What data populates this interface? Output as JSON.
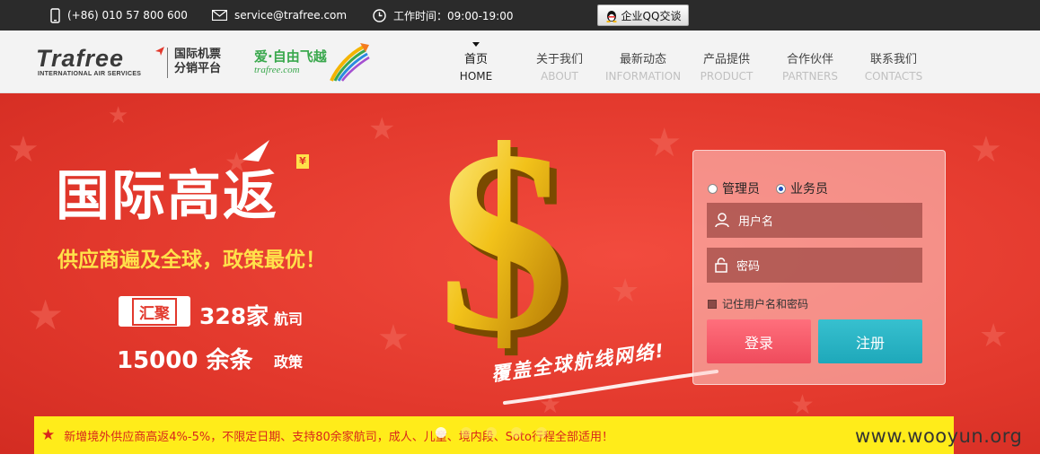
{
  "topbar": {
    "phone": "(+86) 010 57 800 600",
    "email": "service@trafree.com",
    "hours": "工作时间：09:00-19:00",
    "qq_button": "企业QQ交谈"
  },
  "logo": {
    "brand": "Trafree",
    "tagline_en": "INTERNATIONAL AIR SERVICES",
    "cn_line1": "国际机票",
    "cn_line2": "分销平台"
  },
  "partner_logo": {
    "cn": "爱·自由飞越",
    "url": "trafree.com"
  },
  "nav": [
    {
      "cn": "首页",
      "en": "HOME",
      "active": true
    },
    {
      "cn": "关于我们",
      "en": "ABOUT",
      "active": false
    },
    {
      "cn": "最新动态",
      "en": "INFORMATION",
      "active": false
    },
    {
      "cn": "产品提供",
      "en": "PRODUCT",
      "active": false
    },
    {
      "cn": "合作伙伴",
      "en": "PARTNERS",
      "active": false
    },
    {
      "cn": "联系我们",
      "en": "CONTACTS",
      "active": false
    }
  ],
  "banner": {
    "title": "国际高返",
    "title_mark": "¥",
    "slogan": "供应商遍及全球，政策最优！",
    "badge": "汇聚",
    "stat1": "328家",
    "stat1_suffix": "航司",
    "stat2": "15000 余条",
    "stat2_suffix": "政策",
    "tagline": "覆盖全球航线网络!",
    "dollar": "$"
  },
  "login": {
    "role_admin": "管理员",
    "role_sales": "业务员",
    "selected_role": "业务员",
    "username_placeholder": "用户名",
    "password_placeholder": "密码",
    "remember": "记住用户名和密码",
    "login_button": "登录",
    "register_button": "注册"
  },
  "notice": {
    "star": "★",
    "text": "新增境外供应商高返4%-5%，不限定日期、支持80余家航司，成人、儿童、境内段、Soto行程全部适用！"
  },
  "carousel": {
    "count": 5,
    "active_index": 0
  },
  "watermark": "www.wooyun.org",
  "colors": {
    "banner_red": "#e2382c",
    "slogan_yellow": "#ffe14a",
    "notice_yellow": "#ffec1a",
    "login_pink": "#ef4b5c",
    "register_teal": "#1ea8ba",
    "topbar": "#2b2b2b"
  }
}
